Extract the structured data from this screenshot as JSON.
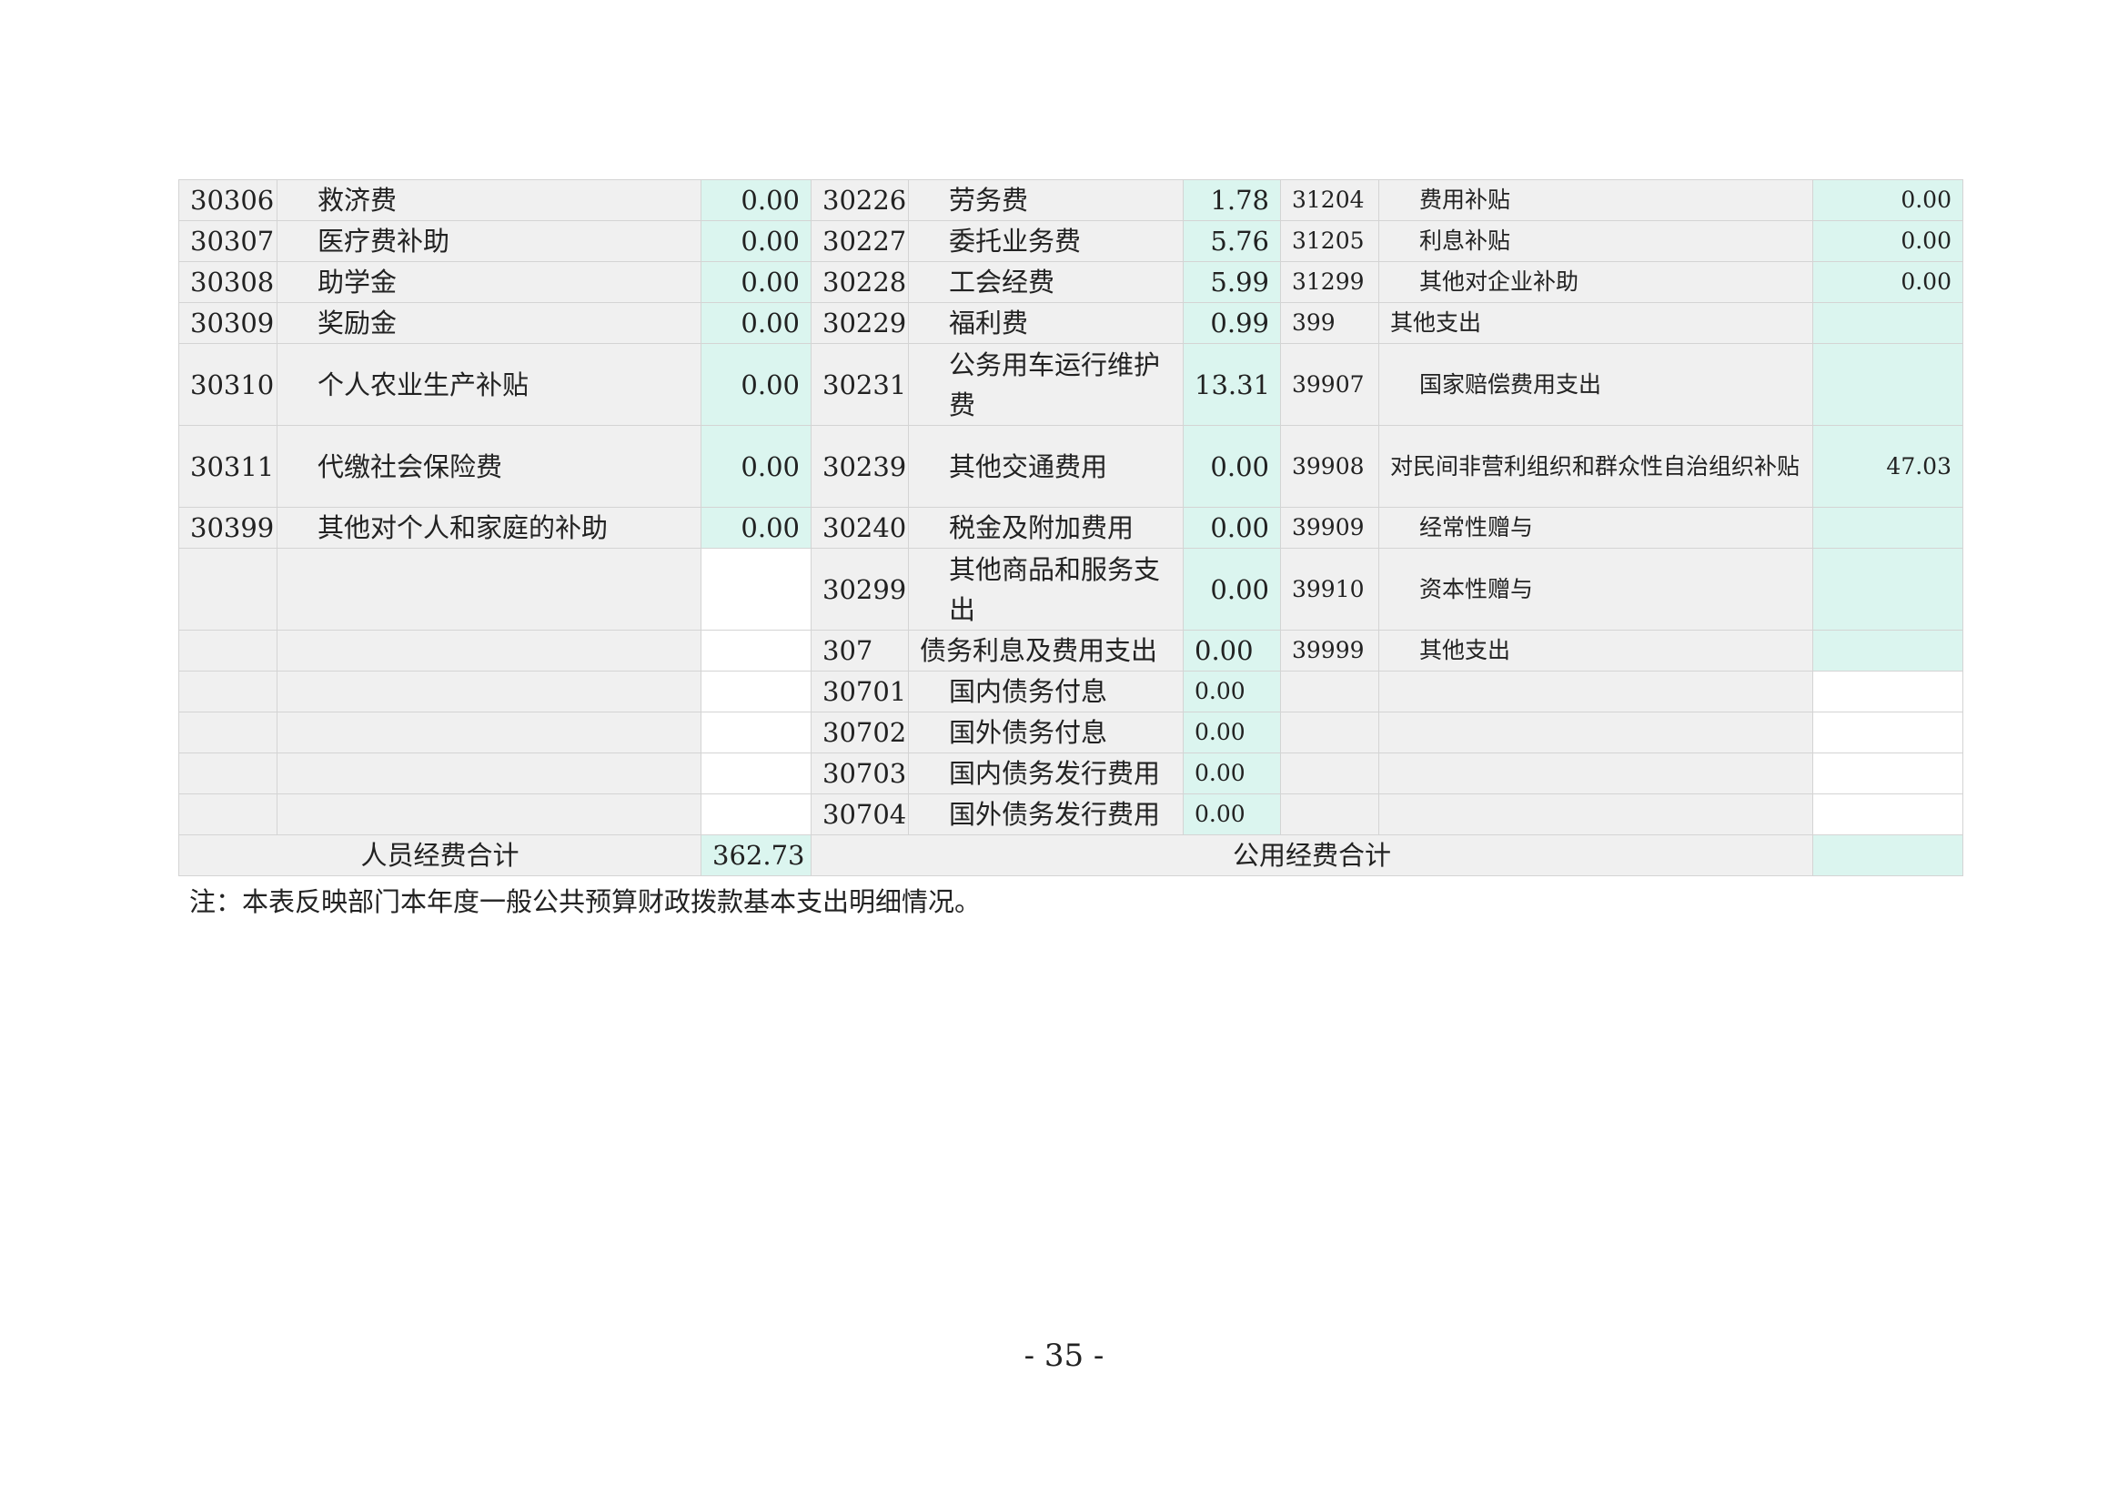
{
  "table": {
    "rows": [
      {
        "c1": "30306",
        "n1": "救济费",
        "v1": "0.00",
        "c2": "30226",
        "n2": "劳务费",
        "v2": "1.78",
        "c3": "31204",
        "n3": "费用补贴",
        "v3": "0.00"
      },
      {
        "c1": "30307",
        "n1": "医疗费补助",
        "v1": "0.00",
        "c2": "30227",
        "n2": "委托业务费",
        "v2": "5.76",
        "c3": "31205",
        "n3": "利息补贴",
        "v3": "0.00"
      },
      {
        "c1": "30308",
        "n1": "助学金",
        "v1": "0.00",
        "c2": "30228",
        "n2": "工会经费",
        "v2": "5.99",
        "c3": "31299",
        "n3": "其他对企业补助",
        "v3": "0.00"
      },
      {
        "c1": "30309",
        "n1": "奖励金",
        "v1": "0.00",
        "c2": "30229",
        "n2": "福利费",
        "v2": "0.99",
        "c3": "399",
        "n3": "其他支出",
        "v3": ""
      },
      {
        "c1": "30310",
        "n1": "个人农业生产补贴",
        "v1": "0.00",
        "c2": "30231",
        "n2": "公务用车运行维护费",
        "v2": "13.31",
        "c3": "39907",
        "n3": "国家赔偿费用支出",
        "v3": ""
      },
      {
        "c1": "30311",
        "n1": "代缴社会保险费",
        "v1": "0.00",
        "c2": "30239",
        "n2": "其他交通费用",
        "v2": "0.00",
        "c3": "39908",
        "n3": "对民间非营利组织和群众性自治组织补贴",
        "v3": "47.03"
      },
      {
        "c1": "30399",
        "n1": "其他对个人和家庭的补助",
        "v1": "0.00",
        "c2": "30240",
        "n2": "税金及附加费用",
        "v2": "0.00",
        "c3": "39909",
        "n3": "经常性赠与",
        "v3": ""
      },
      {
        "c1": "",
        "n1": "",
        "v1": "",
        "c2": "30299",
        "n2": "其他商品和服务支出",
        "v2": "0.00",
        "c3": "39910",
        "n3": "资本性赠与",
        "v3": ""
      },
      {
        "c1": "",
        "n1": "",
        "v1": "",
        "c2": "307",
        "n2": "债务利息及费用支出",
        "v2": "0.00",
        "c3": "39999",
        "n3": "其他支出",
        "v3": ""
      },
      {
        "c1": "",
        "n1": "",
        "v1": "",
        "c2": "30701",
        "n2": "国内债务付息",
        "v2": "0.00",
        "c3": "",
        "n3": "",
        "v3": ""
      },
      {
        "c1": "",
        "n1": "",
        "v1": "",
        "c2": "30702",
        "n2": "国外债务付息",
        "v2": "0.00",
        "c3": "",
        "n3": "",
        "v3": ""
      },
      {
        "c1": "",
        "n1": "",
        "v1": "",
        "c2": "30703",
        "n2": "国内债务发行费用",
        "v2": "0.00",
        "c3": "",
        "n3": "",
        "v3": ""
      },
      {
        "c1": "",
        "n1": "",
        "v1": "",
        "c2": "30704",
        "n2": "国外债务发行费用",
        "v2": "0.00",
        "c3": "",
        "n3": "",
        "v3": ""
      }
    ],
    "totals": {
      "personnel_label": "人员经费合计",
      "personnel_value": "362.73",
      "public_label": "公用经费合计",
      "public_value": ""
    }
  },
  "note": "注：本表反映部门本年度一般公共预算财政拨款基本支出明细情况。",
  "page_number": "- 35 -"
}
